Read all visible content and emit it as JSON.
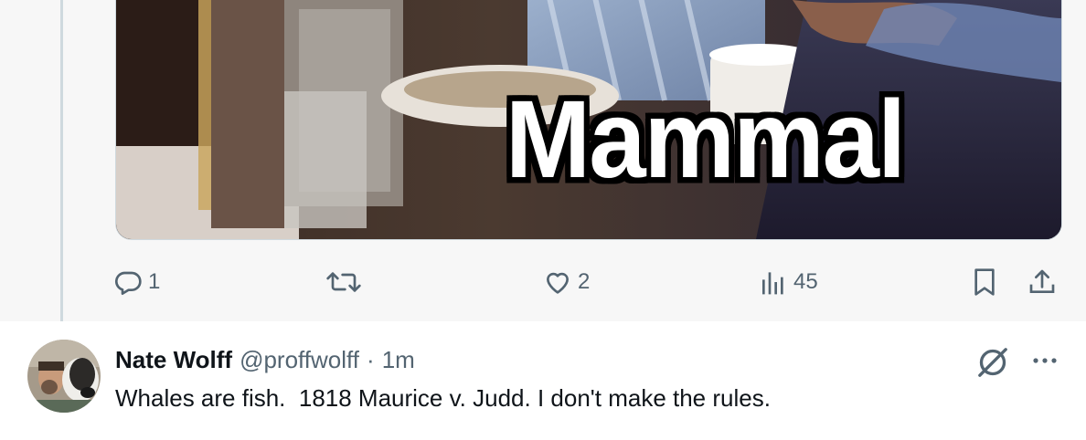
{
  "media": {
    "caption": "Mammal"
  },
  "actions": {
    "reply_count": "1",
    "like_count": "2",
    "views_count": "45"
  },
  "reply": {
    "display_name": "Nate Wolff",
    "handle": "@proffwolff",
    "separator": "·",
    "time": "1m",
    "text": "Whales are fish.  1818 Maurice v. Judd. I don't make the rules."
  },
  "icons": {
    "reply": "speech-bubble",
    "retweet": "two-arrows-cycle",
    "like": "heart",
    "views": "bar-chart",
    "bookmark": "bookmark",
    "share": "upload-arrow",
    "grok": "slashed-circle-grok",
    "more": "three-dots"
  },
  "colors": {
    "muted_text": "#536471",
    "primary_text": "#0f1419",
    "focus_background": "#f7f7f7",
    "thread_line": "#cfd9de"
  }
}
